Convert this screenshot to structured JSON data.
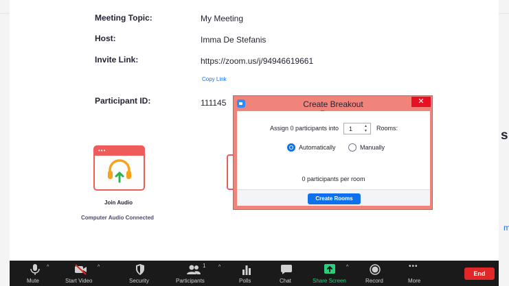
{
  "meeting": {
    "topic_label": "Meeting Topic:",
    "topic_value": "My Meeting",
    "host_label": "Host:",
    "host_value": "Imma De Stefanis",
    "invite_label": "Invite Link:",
    "invite_value": "https://zoom.us/j/94946619661",
    "copy_link": "Copy Link",
    "participant_label": "Participant ID:",
    "participant_value": "111145"
  },
  "audio": {
    "join_label": "Join Audio",
    "status": "Computer Audio Connected",
    "icon": "headphones-arrow-icon"
  },
  "edge_text": {
    "right_char": "s",
    "right_link_char": "m"
  },
  "dialog": {
    "title": "Create Breakout Rooms",
    "close": "✕",
    "assign_text": "Assign 0 participants into",
    "rooms_value": "1",
    "rooms_text": "Rooms:",
    "option_auto": "Automatically",
    "option_manual": "Manually",
    "selected_option": "Automatically",
    "per_room": "0 participants per room",
    "create_button": "Create Rooms"
  },
  "toolbar": {
    "mute": "Mute",
    "start_video": "Start Video",
    "security": "Security",
    "participants": "Participants",
    "participants_count": "1",
    "polls": "Polls",
    "chat": "Chat",
    "share_screen": "Share Screen",
    "record": "Record",
    "more": "More",
    "end": "End"
  },
  "colors": {
    "accent_blue": "#0e71eb",
    "dialog_frame": "#f0847a",
    "tile_red": "#ef5b5b",
    "share_green": "#26d07c",
    "end_red": "#e02828",
    "toolbar_bg": "#1a1a1a"
  }
}
